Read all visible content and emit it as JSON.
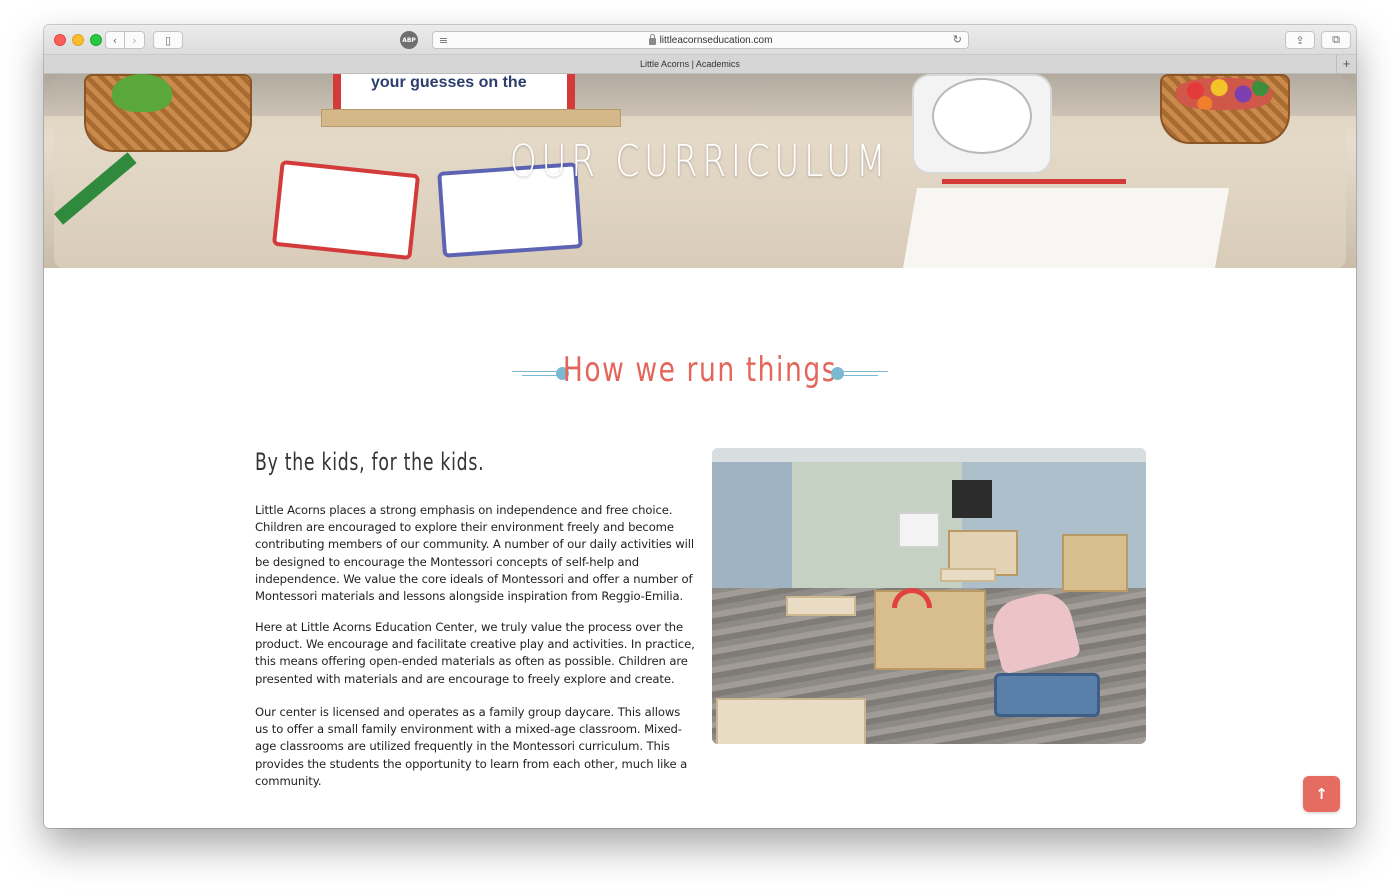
{
  "browser": {
    "url": "littleacornseducation.com",
    "tab_title": "Little Acorns | Academics",
    "adblock_label": "ABP",
    "new_tab_label": "+"
  },
  "hero": {
    "title": "OUR CURRICULUM",
    "easel_text": "your guesses on the"
  },
  "section": {
    "heading": "How we run things",
    "subheading": "By the kids, for the kids.",
    "paragraphs": [
      "Little Acorns places a strong emphasis on independence and free choice. Children are encouraged to explore their environment freely and become contributing members of our community. A number of our daily activities will be designed to encourage the Montessori concepts of self-help and independence. We value the core ideals of Montessori and offer a number of Montessori materials and lessons alongside inspiration from Reggio-Emilia.",
      "Here at Little Acorns Education Center, we truly value the process over the product. We encourage and facilitate creative play and activities. In practice, this means offering open-ended materials as often as possible. Children are presented with materials and are encourage to freely explore and create.",
      "Our center is licensed and operates as a family group daycare. This allows us to offer a small family environment with a mixed-age classroom. Mixed-age classrooms are utilized frequently in the Montessori curriculum. This provides the students the opportunity to learn from each other, much like a community."
    ]
  },
  "colors": {
    "accent_coral": "#e4655a",
    "ornament_blue": "#7bb8d2",
    "back_to_top": "#e66b61"
  },
  "icons": {
    "back_to_top": "arrow-up-icon"
  }
}
